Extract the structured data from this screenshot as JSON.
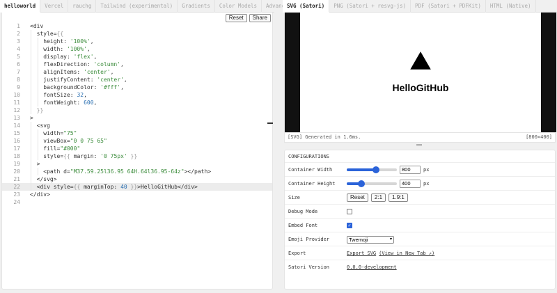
{
  "editor": {
    "tabs": [
      {
        "label": "helloworld",
        "active": true
      },
      {
        "label": "Vercel",
        "active": false
      },
      {
        "label": "rauchg",
        "active": false
      },
      {
        "label": "Tailwind (experimental)",
        "active": false
      },
      {
        "label": "Gradients",
        "active": false
      },
      {
        "label": "Color Models",
        "active": false
      },
      {
        "label": "Advanced",
        "active": false
      }
    ],
    "reset_label": "Reset",
    "share_label": "Share",
    "lines": [
      {
        "n": "1",
        "code": "<div"
      },
      {
        "n": "2",
        "code": "  style={{"
      },
      {
        "n": "3",
        "code": "    height: '100%',"
      },
      {
        "n": "4",
        "code": "    width: '100%',"
      },
      {
        "n": "5",
        "code": "    display: 'flex',"
      },
      {
        "n": "6",
        "code": "    flexDirection: 'column',"
      },
      {
        "n": "7",
        "code": "    alignItems: 'center',"
      },
      {
        "n": "8",
        "code": "    justifyContent: 'center',"
      },
      {
        "n": "9",
        "code": "    backgroundColor: '#fff',"
      },
      {
        "n": "10",
        "code": "    fontSize: 32,"
      },
      {
        "n": "11",
        "code": "    fontWeight: 600,"
      },
      {
        "n": "12",
        "code": "  }}"
      },
      {
        "n": "13",
        "code": ">"
      },
      {
        "n": "14",
        "code": "  <svg"
      },
      {
        "n": "15",
        "code": "    width=\"75\""
      },
      {
        "n": "16",
        "code": "    viewBox=\"0 0 75 65\""
      },
      {
        "n": "17",
        "code": "    fill=\"#000\""
      },
      {
        "n": "18",
        "code": "    style={{ margin: '0 75px' }}"
      },
      {
        "n": "19",
        "code": "  >"
      },
      {
        "n": "20",
        "code": "    <path d=\"M37.59.25l36.95 64H.64l36.95-64z\"></path>"
      },
      {
        "n": "21",
        "code": "  </svg>"
      },
      {
        "n": "22",
        "code": "  <div style={{ marginTop: 40 }}>HelloGitHub</div>"
      },
      {
        "n": "23",
        "code": "</div>"
      },
      {
        "n": "24",
        "code": ""
      }
    ],
    "highlight_line": 22
  },
  "preview": {
    "tabs": [
      {
        "label": "SVG (Satori)",
        "active": true
      },
      {
        "label": "PNG (Satori + resvg-js)",
        "active": false
      },
      {
        "label": "PDF (Satori + PDFKit)",
        "active": false
      },
      {
        "label": "HTML (Native)",
        "active": false
      }
    ],
    "rendered_text": "HelloGitHub",
    "status_left": "[SVG] Generated in 1.6ms.",
    "status_right": "[800×400]"
  },
  "config": {
    "heading": "CONFIGURATIONS",
    "container_width": {
      "label": "Container Width",
      "value": "800",
      "unit": "px",
      "level": 0.58
    },
    "container_height": {
      "label": "Container Height",
      "value": "400",
      "unit": "px",
      "level": 0.29
    },
    "size": {
      "label": "Size",
      "buttons": [
        "Reset",
        "2:1",
        "1.9:1"
      ]
    },
    "debug_mode": {
      "label": "Debug Mode",
      "checked": false
    },
    "embed_font": {
      "label": "Embed Font",
      "checked": true
    },
    "emoji_provider": {
      "label": "Emoji Provider",
      "value": "Twemoji"
    },
    "export": {
      "label": "Export",
      "link1": "Export SVG",
      "link2": "(View in New Tab ↗)"
    },
    "satori_version": {
      "label": "Satori Version",
      "value": "0.0.0-development"
    }
  },
  "colors": {
    "accent": "#2b63d9",
    "string": "#3a8b3a",
    "number": "#2a6fb1"
  },
  "icons": [
    "triangle-logo",
    "checkmark-icon",
    "chevron-down-icon",
    "external-link-icon"
  ]
}
